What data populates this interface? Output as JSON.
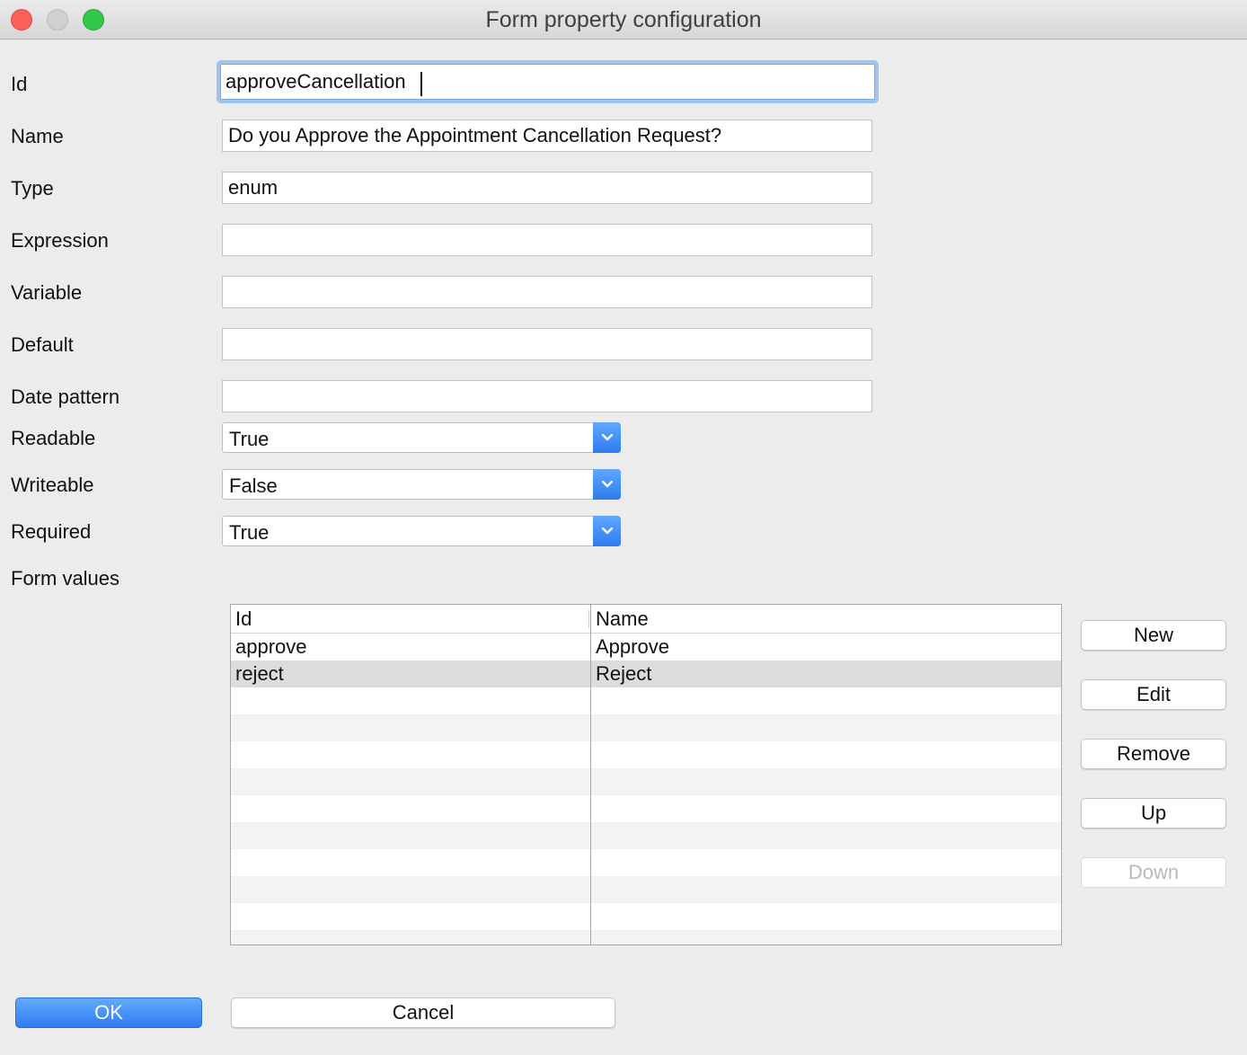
{
  "window": {
    "title": "Form property configuration"
  },
  "form": {
    "id": {
      "label": "Id",
      "value": "approveCancellation"
    },
    "name": {
      "label": "Name",
      "value": "Do you Approve the Appointment Cancellation Request?"
    },
    "type": {
      "label": "Type",
      "value": "enum"
    },
    "expression": {
      "label": "Expression",
      "value": ""
    },
    "variable": {
      "label": "Variable",
      "value": ""
    },
    "default": {
      "label": "Default",
      "value": ""
    },
    "date_pattern": {
      "label": "Date pattern",
      "value": ""
    },
    "readable": {
      "label": "Readable",
      "value": "True"
    },
    "writeable": {
      "label": "Writeable",
      "value": "False"
    },
    "required": {
      "label": "Required",
      "value": "True"
    },
    "form_values_label": "Form values"
  },
  "table": {
    "columns": [
      "Id",
      "Name"
    ],
    "rows": [
      {
        "id": "approve",
        "name": "Approve",
        "selected": false
      },
      {
        "id": "reject",
        "name": "Reject",
        "selected": true
      }
    ]
  },
  "side_buttons": {
    "new": "New",
    "edit": "Edit",
    "remove": "Remove",
    "up": "Up",
    "down": "Down"
  },
  "footer": {
    "ok": "OK",
    "cancel": "Cancel"
  },
  "colors": {
    "accent": "#2f7cf0",
    "focus_ring": "#9fc3ec",
    "selected_row": "#dcdcdc"
  },
  "icons": {
    "close": "close-traffic-light",
    "minimize": "minimize-traffic-light",
    "zoom": "zoom-traffic-light",
    "dropdown": "chevron-down-icon"
  }
}
